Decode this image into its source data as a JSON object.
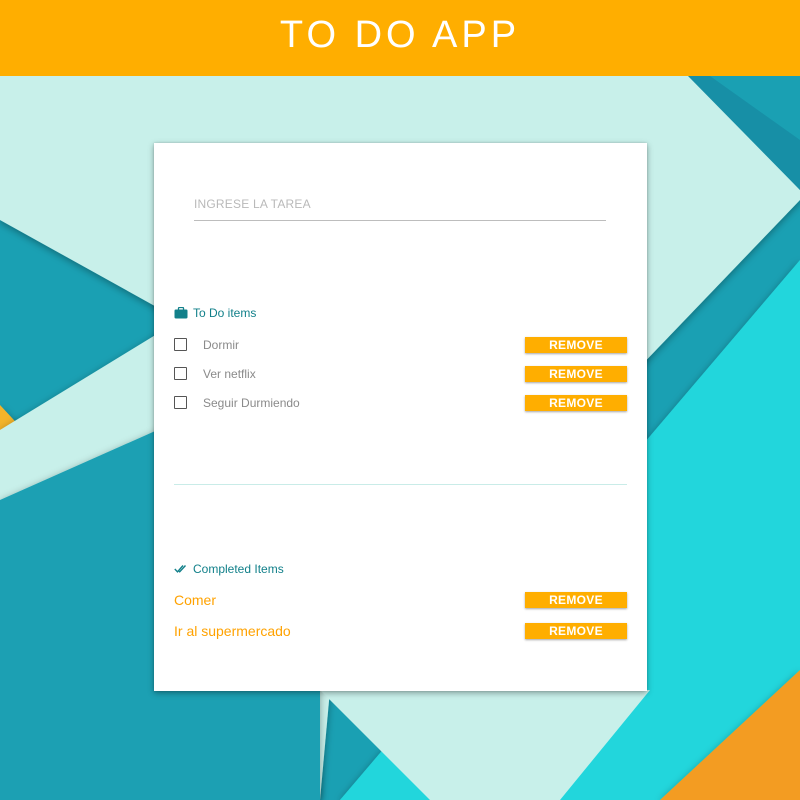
{
  "header": {
    "title": "TO DO APP"
  },
  "task_input": {
    "placeholder": "INGRESE LA TAREA",
    "value": ""
  },
  "todo": {
    "heading": "To Do items",
    "items": [
      {
        "label": "Dormir",
        "remove_label": "REMOVE"
      },
      {
        "label": "Ver netflix",
        "remove_label": "REMOVE"
      },
      {
        "label": "Seguir Durmiendo",
        "remove_label": "REMOVE"
      }
    ]
  },
  "completed": {
    "heading": "Completed Items",
    "items": [
      {
        "label": "Comer",
        "remove_label": "REMOVE"
      },
      {
        "label": "Ir al supermercado",
        "remove_label": "REMOVE"
      }
    ]
  },
  "icons": {
    "todo_heading": "briefcase-icon",
    "completed_heading": "double-check-icon"
  },
  "colors": {
    "accent": "#ffae00",
    "teal": "#12808a",
    "completed_text": "#ffa200",
    "background_light": "#c8f0ea",
    "background_cyan": "#24d6dc",
    "background_teal": "#1aa0b3"
  }
}
